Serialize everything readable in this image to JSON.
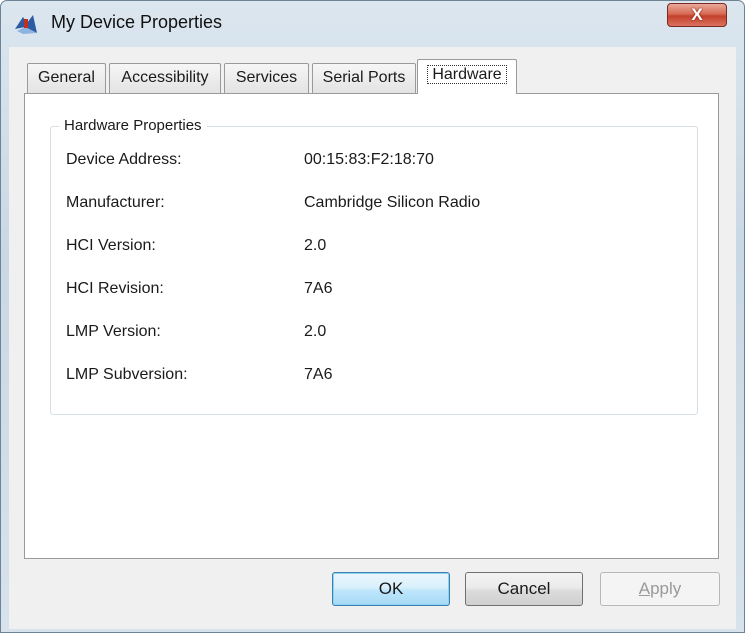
{
  "window": {
    "title": "My Device Properties",
    "close_label": "X"
  },
  "tabs": [
    {
      "label": "General"
    },
    {
      "label": "Accessibility"
    },
    {
      "label": "Services"
    },
    {
      "label": "Serial Ports"
    },
    {
      "label": "Hardware",
      "active": true
    }
  ],
  "hardware": {
    "group_title": "Hardware Properties",
    "rows": [
      {
        "label": "Device Address:",
        "value": "00:15:83:F2:18:70"
      },
      {
        "label": "Manufacturer:",
        "value": "Cambridge Silicon Radio"
      },
      {
        "label": "HCI Version:",
        "value": "2.0"
      },
      {
        "label": "HCI Revision:",
        "value": "7A6"
      },
      {
        "label": "LMP Version:",
        "value": "2.0"
      },
      {
        "label": "LMP Subversion:",
        "value": "7A6"
      }
    ]
  },
  "buttons": {
    "ok": "OK",
    "cancel": "Cancel",
    "apply_first": "A",
    "apply_rest": "pply"
  },
  "icons": {
    "app": "bluetooth-device-icon",
    "close": "close-icon"
  }
}
